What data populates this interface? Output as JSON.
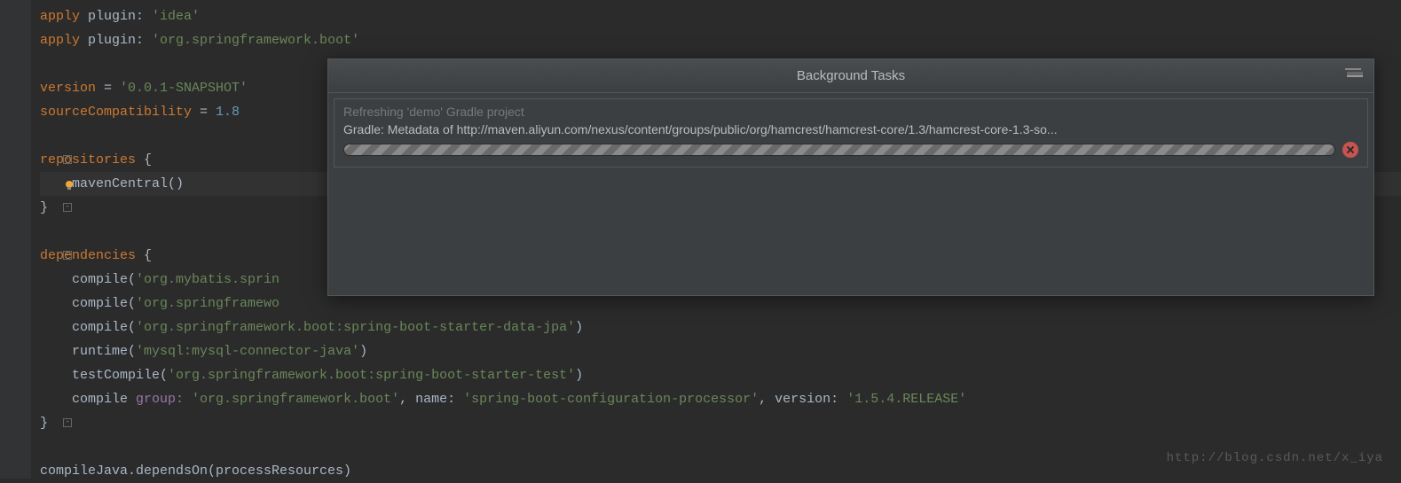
{
  "code": {
    "line1_apply": "apply",
    "line1_plugin": " plugin: ",
    "line1_val": "'idea'",
    "line2_apply": "apply",
    "line2_plugin": " plugin: ",
    "line2_val": "'org.springframework.boot'",
    "line4_version": "version",
    "line4_eq": " = ",
    "line4_val": "'0.0.1-SNAPSHOT'",
    "line5_sc": "sourceCompatibility",
    "line5_eq": " = ",
    "line5_val": "1.8",
    "line7_repo": "repositories ",
    "line7_brace": "{",
    "line8_mc": "    mavenCentral()",
    "line9_close": "}",
    "line11_dep": "dependencies ",
    "line11_brace": "{",
    "line12_compile": "    compile(",
    "line12_val": "'org.mybatis.sprin",
    "line13_compile": "    compile(",
    "line13_val": "'org.springframewo",
    "line14_compile": "    compile(",
    "line14_val": "'org.springframework.boot:spring-boot-starter-data-jpa'",
    "line14_close": ")",
    "line15_runtime": "    runtime(",
    "line15_val": "'mysql:mysql-connector-java'",
    "line15_close": ")",
    "line16_tc": "    testCompile(",
    "line16_val": "'org.springframework.boot:spring-boot-starter-test'",
    "line16_close": ")",
    "line17_compile": "    compile ",
    "line17_group": "group: ",
    "line17_gval": "'org.springframework.boot'",
    "line17_name": ", name: ",
    "line17_nval": "'spring-boot-configuration-processor'",
    "line17_ver": ", version: ",
    "line17_vval": "'1.5.4.RELEASE'",
    "line18_close": "}",
    "line20": "compileJava.dependsOn(processResources)"
  },
  "dialog": {
    "title": "Background Tasks",
    "task_label": "Refreshing 'demo' Gradle project",
    "task_detail": "Gradle: Metadata of http://maven.aliyun.com/nexus/content/groups/public/org/hamcrest/hamcrest-core/1.3/hamcrest-core-1.3-so..."
  },
  "watermark": "http://blog.csdn.net/x_iya"
}
